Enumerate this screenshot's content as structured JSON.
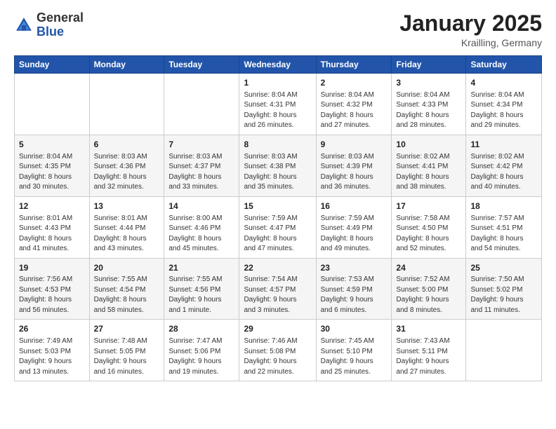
{
  "header": {
    "logo_general": "General",
    "logo_blue": "Blue",
    "month": "January 2025",
    "location": "Krailling, Germany"
  },
  "weekdays": [
    "Sunday",
    "Monday",
    "Tuesday",
    "Wednesday",
    "Thursday",
    "Friday",
    "Saturday"
  ],
  "weeks": [
    [
      {
        "day": "",
        "info": ""
      },
      {
        "day": "",
        "info": ""
      },
      {
        "day": "",
        "info": ""
      },
      {
        "day": "1",
        "info": "Sunrise: 8:04 AM\nSunset: 4:31 PM\nDaylight: 8 hours\nand 26 minutes."
      },
      {
        "day": "2",
        "info": "Sunrise: 8:04 AM\nSunset: 4:32 PM\nDaylight: 8 hours\nand 27 minutes."
      },
      {
        "day": "3",
        "info": "Sunrise: 8:04 AM\nSunset: 4:33 PM\nDaylight: 8 hours\nand 28 minutes."
      },
      {
        "day": "4",
        "info": "Sunrise: 8:04 AM\nSunset: 4:34 PM\nDaylight: 8 hours\nand 29 minutes."
      }
    ],
    [
      {
        "day": "5",
        "info": "Sunrise: 8:04 AM\nSunset: 4:35 PM\nDaylight: 8 hours\nand 30 minutes."
      },
      {
        "day": "6",
        "info": "Sunrise: 8:03 AM\nSunset: 4:36 PM\nDaylight: 8 hours\nand 32 minutes."
      },
      {
        "day": "7",
        "info": "Sunrise: 8:03 AM\nSunset: 4:37 PM\nDaylight: 8 hours\nand 33 minutes."
      },
      {
        "day": "8",
        "info": "Sunrise: 8:03 AM\nSunset: 4:38 PM\nDaylight: 8 hours\nand 35 minutes."
      },
      {
        "day": "9",
        "info": "Sunrise: 8:03 AM\nSunset: 4:39 PM\nDaylight: 8 hours\nand 36 minutes."
      },
      {
        "day": "10",
        "info": "Sunrise: 8:02 AM\nSunset: 4:41 PM\nDaylight: 8 hours\nand 38 minutes."
      },
      {
        "day": "11",
        "info": "Sunrise: 8:02 AM\nSunset: 4:42 PM\nDaylight: 8 hours\nand 40 minutes."
      }
    ],
    [
      {
        "day": "12",
        "info": "Sunrise: 8:01 AM\nSunset: 4:43 PM\nDaylight: 8 hours\nand 41 minutes."
      },
      {
        "day": "13",
        "info": "Sunrise: 8:01 AM\nSunset: 4:44 PM\nDaylight: 8 hours\nand 43 minutes."
      },
      {
        "day": "14",
        "info": "Sunrise: 8:00 AM\nSunset: 4:46 PM\nDaylight: 8 hours\nand 45 minutes."
      },
      {
        "day": "15",
        "info": "Sunrise: 7:59 AM\nSunset: 4:47 PM\nDaylight: 8 hours\nand 47 minutes."
      },
      {
        "day": "16",
        "info": "Sunrise: 7:59 AM\nSunset: 4:49 PM\nDaylight: 8 hours\nand 49 minutes."
      },
      {
        "day": "17",
        "info": "Sunrise: 7:58 AM\nSunset: 4:50 PM\nDaylight: 8 hours\nand 52 minutes."
      },
      {
        "day": "18",
        "info": "Sunrise: 7:57 AM\nSunset: 4:51 PM\nDaylight: 8 hours\nand 54 minutes."
      }
    ],
    [
      {
        "day": "19",
        "info": "Sunrise: 7:56 AM\nSunset: 4:53 PM\nDaylight: 8 hours\nand 56 minutes."
      },
      {
        "day": "20",
        "info": "Sunrise: 7:55 AM\nSunset: 4:54 PM\nDaylight: 8 hours\nand 58 minutes."
      },
      {
        "day": "21",
        "info": "Sunrise: 7:55 AM\nSunset: 4:56 PM\nDaylight: 9 hours\nand 1 minute."
      },
      {
        "day": "22",
        "info": "Sunrise: 7:54 AM\nSunset: 4:57 PM\nDaylight: 9 hours\nand 3 minutes."
      },
      {
        "day": "23",
        "info": "Sunrise: 7:53 AM\nSunset: 4:59 PM\nDaylight: 9 hours\nand 6 minutes."
      },
      {
        "day": "24",
        "info": "Sunrise: 7:52 AM\nSunset: 5:00 PM\nDaylight: 9 hours\nand 8 minutes."
      },
      {
        "day": "25",
        "info": "Sunrise: 7:50 AM\nSunset: 5:02 PM\nDaylight: 9 hours\nand 11 minutes."
      }
    ],
    [
      {
        "day": "26",
        "info": "Sunrise: 7:49 AM\nSunset: 5:03 PM\nDaylight: 9 hours\nand 13 minutes."
      },
      {
        "day": "27",
        "info": "Sunrise: 7:48 AM\nSunset: 5:05 PM\nDaylight: 9 hours\nand 16 minutes."
      },
      {
        "day": "28",
        "info": "Sunrise: 7:47 AM\nSunset: 5:06 PM\nDaylight: 9 hours\nand 19 minutes."
      },
      {
        "day": "29",
        "info": "Sunrise: 7:46 AM\nSunset: 5:08 PM\nDaylight: 9 hours\nand 22 minutes."
      },
      {
        "day": "30",
        "info": "Sunrise: 7:45 AM\nSunset: 5:10 PM\nDaylight: 9 hours\nand 25 minutes."
      },
      {
        "day": "31",
        "info": "Sunrise: 7:43 AM\nSunset: 5:11 PM\nDaylight: 9 hours\nand 27 minutes."
      },
      {
        "day": "",
        "info": ""
      }
    ]
  ]
}
